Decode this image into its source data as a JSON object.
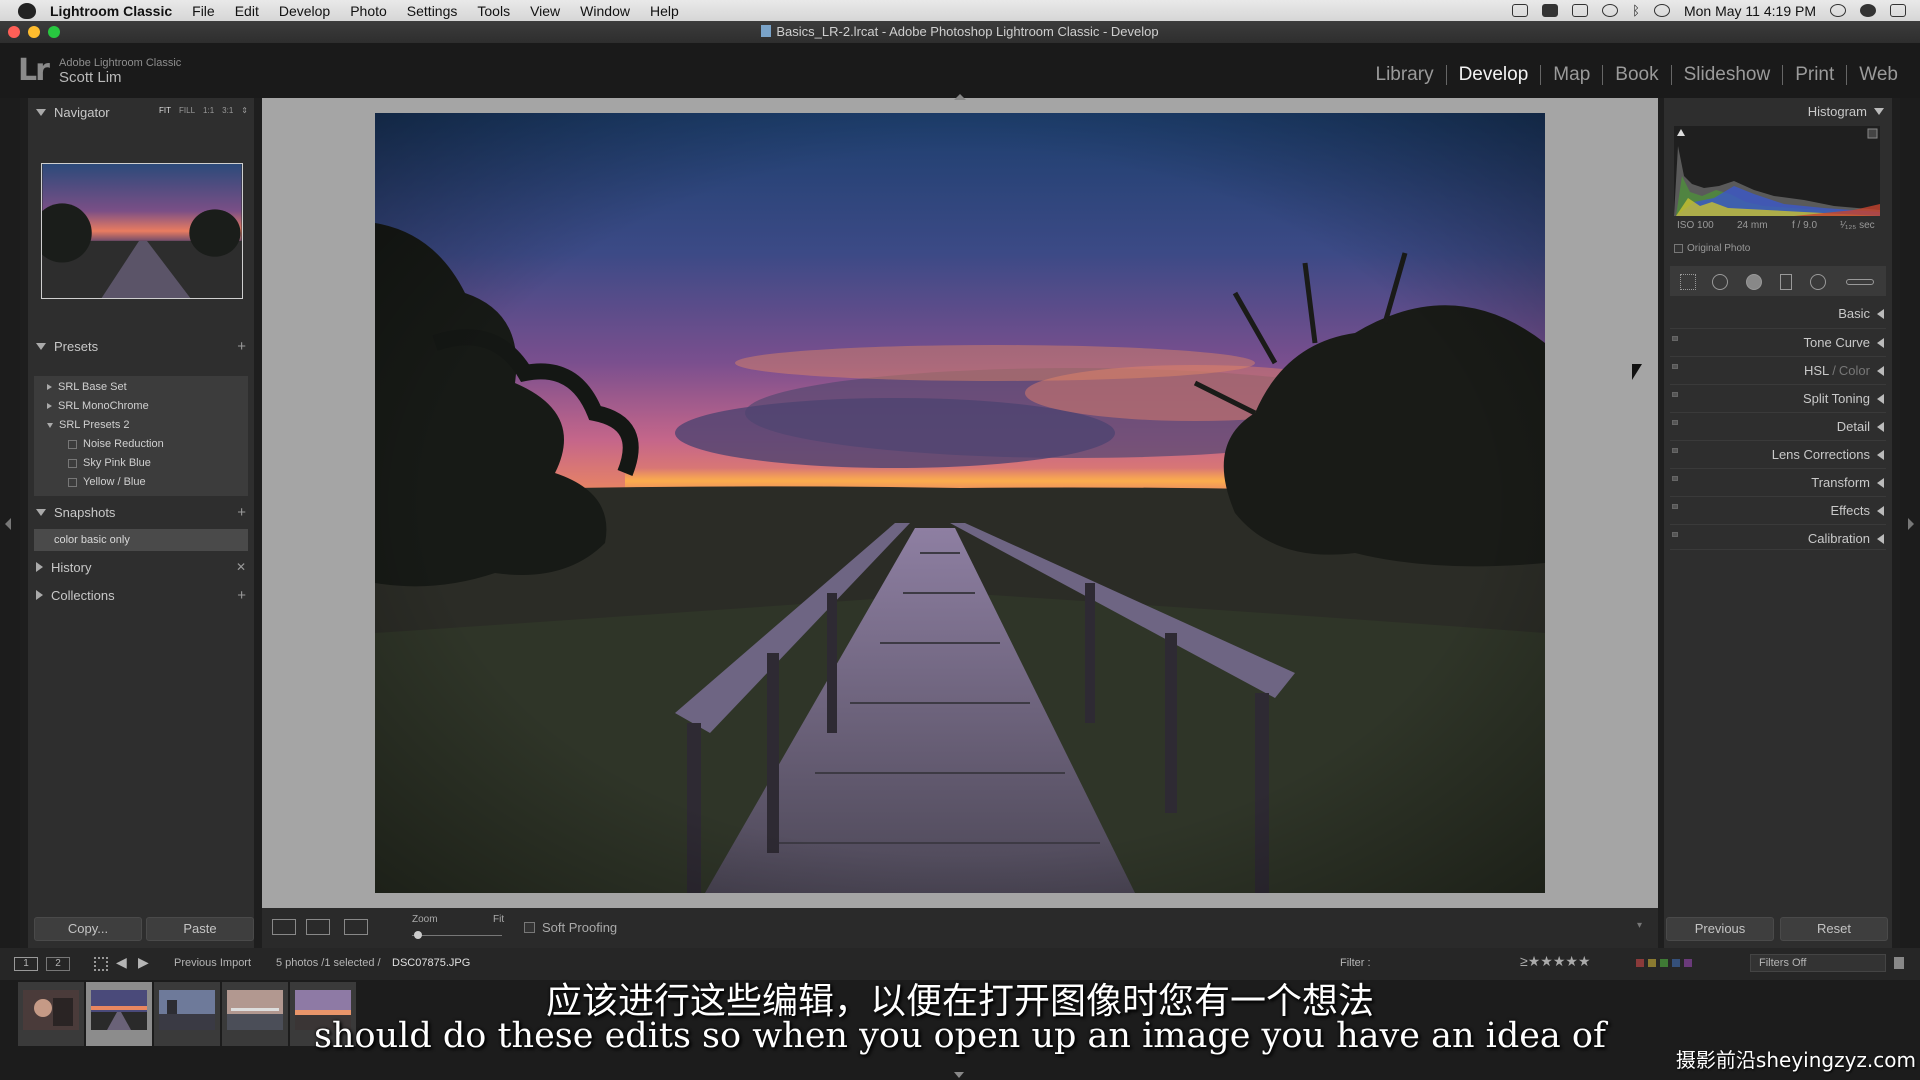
{
  "menubar": {
    "app": "Lightroom Classic",
    "items": [
      "File",
      "Edit",
      "Develop",
      "Photo",
      "Settings",
      "Tools",
      "View",
      "Window",
      "Help"
    ],
    "clock": "Mon May 11  4:19 PM"
  },
  "window": {
    "title": "Basics_LR-2.lrcat - Adobe Photoshop Lightroom Classic - Develop"
  },
  "identity": {
    "logo": "Lr",
    "app_small": "Adobe Lightroom Classic",
    "user": "Scott Lim"
  },
  "modules": {
    "items": [
      "Library",
      "Develop",
      "Map",
      "Book",
      "Slideshow",
      "Print",
      "Web"
    ],
    "active": "Develop"
  },
  "left_panel": {
    "navigator": {
      "title": "Navigator",
      "modes": [
        "FIT",
        "FILL",
        "1:1",
        "3:1"
      ]
    },
    "presets": {
      "title": "Presets",
      "items": [
        "SRL Base Set",
        "SRL MonoChrome",
        "SRL Presets 2",
        "Noise Reduction",
        "Sky Pink Blue",
        "Yellow / Blue"
      ]
    },
    "snapshots": {
      "title": "Snapshots",
      "item": "color basic only"
    },
    "history": {
      "title": "History"
    },
    "collections": {
      "title": "Collections"
    },
    "copy_label": "Copy...",
    "paste_label": "Paste"
  },
  "toolbar": {
    "zoom_label": "Zoom",
    "fit_label": "Fit",
    "soft_proofing": "Soft Proofing"
  },
  "right_panel": {
    "histogram_title": "Histogram",
    "exif": {
      "iso": "ISO 100",
      "focal": "24 mm",
      "aperture": "f / 9.0",
      "shutter": "¹⁄₁₂₅ sec"
    },
    "original_photo": "Original Photo",
    "panels": [
      "Basic",
      "Tone Curve",
      "HSL",
      "Color",
      "Split Toning",
      "Detail",
      "Lens Corrections",
      "Transform",
      "Effects",
      "Calibration"
    ],
    "previous_label": "Previous",
    "reset_label": "Reset"
  },
  "filmstrip_bar": {
    "screen1": "1",
    "screen2": "2",
    "source": "Previous Import",
    "count": "5 photos /1 selected /",
    "filename": "DSC07875.JPG",
    "filter_label": "Filter :",
    "filters_off": "Filters Off"
  },
  "subtitles": {
    "cn": "应该进行这些编辑，以便在打开图像时您有一个想法",
    "en": "should do these edits so when you open up an image you have an idea of"
  },
  "watermark": "摄影前沿sheyingzyz.com"
}
